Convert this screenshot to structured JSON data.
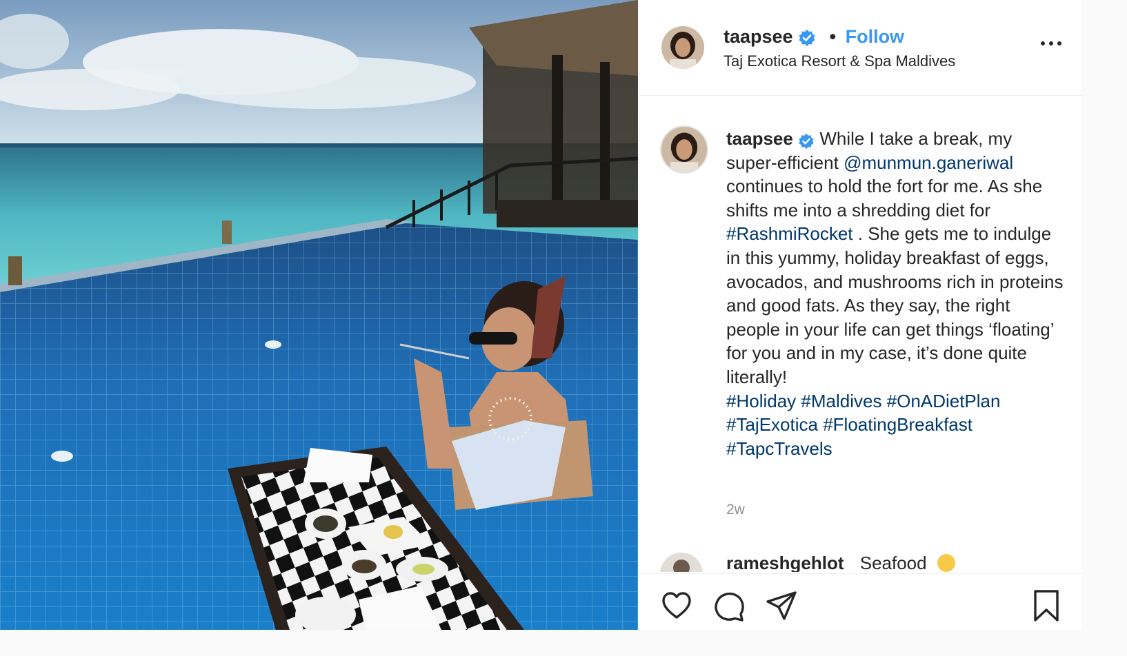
{
  "post": {
    "username": "taapsee",
    "separator": "•",
    "follow_label": "Follow",
    "location": "Taj Exotica Resort & Spa Maldives",
    "caption": {
      "username": "taapsee",
      "text_1": "While I take a break, my super-efficient",
      "mention": "@munmun.ganeriwal",
      "text_2": "continues to hold the fort for me. As she shifts me into a shredding diet for",
      "hashtag_main": "#RashmiRocket",
      "text_3": ". She gets me to indulge in this yummy, holiday breakfast of eggs, avocados, and mushrooms rich in proteins and good fats. As they say, the right people in your life can get things ‘floating’ for you and in my case, it’s done quite literally!",
      "hashtags": [
        "#Holiday",
        "#Maldives",
        "#OnADietPlan",
        "#TajExotica",
        "#FloatingBreakfast",
        "#TapcTravels"
      ]
    },
    "timestamp": "2w",
    "comment": {
      "username": "rameshgehlot",
      "text": "Seafood"
    },
    "icons": {
      "more": "more-options-icon",
      "like": "heart-icon",
      "comment": "comment-icon",
      "share": "share-icon",
      "save": "bookmark-icon",
      "verified": "verified-badge-icon"
    },
    "colors": {
      "link": "#00376b",
      "follow": "#3897f0",
      "verified": "#3897f0",
      "muted": "#8e8e8e"
    }
  }
}
